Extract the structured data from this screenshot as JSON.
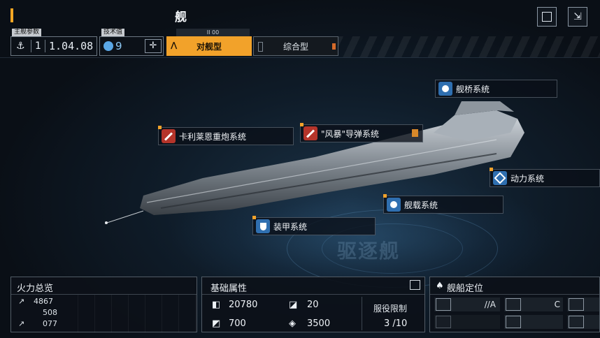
{
  "header": {
    "title": "舰",
    "top_buttons": [
      "square-button",
      "exit-button"
    ]
  },
  "stats": {
    "main_param_label": "主舰参数",
    "version_digit": "1",
    "value": "1.04.08",
    "tech_label": "技术值",
    "tech_value": "9"
  },
  "tabs": [
    {
      "label": "对舰型",
      "active": true
    },
    {
      "label": "综合型",
      "active": false
    }
  ],
  "tab_header": "II 00",
  "systems": [
    {
      "label": "卡利莱恩重炮系统",
      "icon": "cannon-icon"
    },
    {
      "label": "\"风暴\"导弹系统",
      "icon": "missile-icon"
    },
    {
      "label": "舰桥系统",
      "icon": "bridge-icon"
    },
    {
      "label": "动力系统",
      "icon": "engine-icon"
    },
    {
      "label": "舰载系统",
      "icon": "hangar-icon"
    },
    {
      "label": "装甲系统",
      "icon": "armor-icon"
    }
  ],
  "watermark": "驱逐舰",
  "firepower": {
    "title": "火力总览",
    "rows": [
      "4867",
      "508",
      "077"
    ]
  },
  "base_attributes": {
    "title": "基础属性",
    "hp": "20780",
    "armor": "20",
    "speed": "700",
    "cost": "3500",
    "service_limit_label": "服役限制",
    "service_limit_value": "3 /10"
  },
  "ship_position": {
    "title": "舰船定位",
    "slot_a": "//A",
    "slot_b": "C"
  },
  "colors": {
    "accent": "#f2a22a",
    "icon_red": "#b5342a",
    "icon_blue": "#2f6fb0"
  }
}
